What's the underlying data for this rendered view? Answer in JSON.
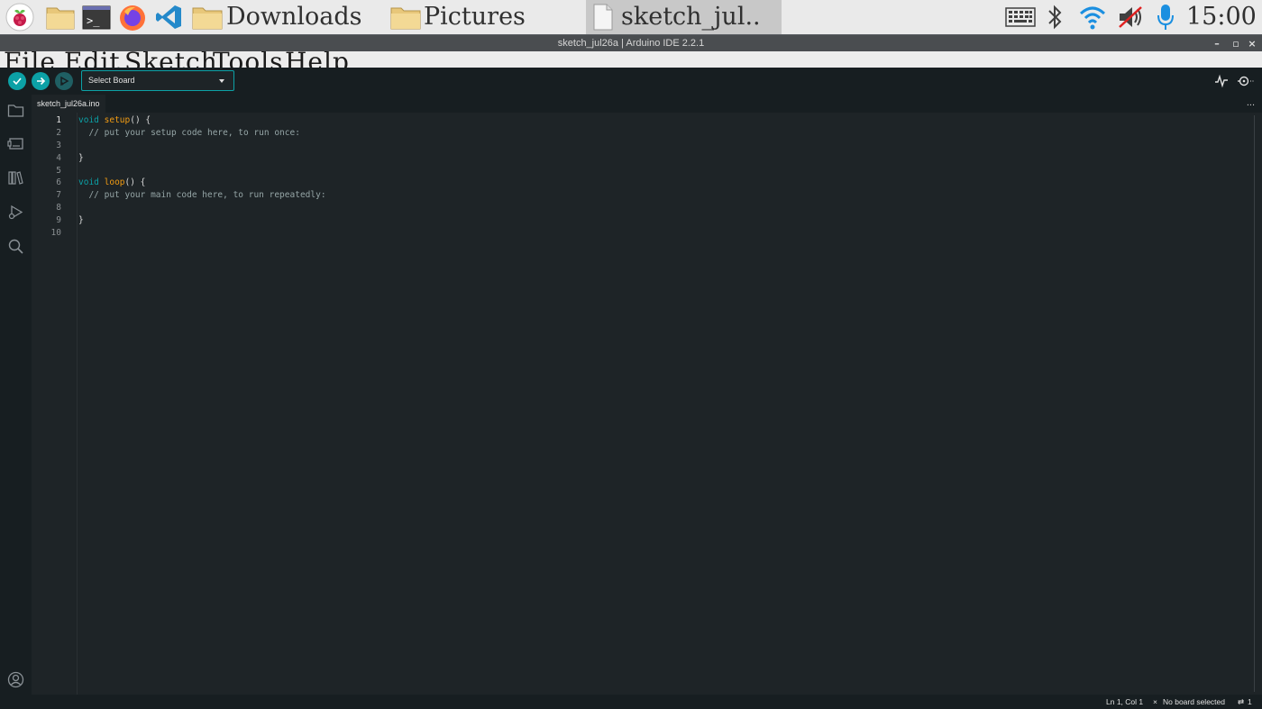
{
  "taskbar": {
    "downloads_label": "Downloads",
    "pictures_label": "Pictures",
    "active_window_label": "sketch_jul..",
    "clock": "15:00"
  },
  "window": {
    "title": "sketch_jul26a | Arduino IDE 2.2.1",
    "minimize": "–",
    "maximize": "▫",
    "close": "×"
  },
  "menu": {
    "file": "File",
    "edit": "Edit",
    "sketch": "Sketch",
    "tools": "Tools",
    "help": "Help"
  },
  "toolbar": {
    "board_select": "Select Board"
  },
  "editor": {
    "tab_label": "sketch_jul26a.ino",
    "more_label": "...",
    "line_numbers": [
      "1",
      "2",
      "3",
      "4",
      "5",
      "6",
      "7",
      "8",
      "9",
      "10"
    ],
    "code": {
      "l1_kw": "void",
      "l1_fn": "setup",
      "l1_rest": "() {",
      "l2": "  // put your setup code here, to run once:",
      "l4": "}",
      "l6_kw": "void",
      "l6_fn": "loop",
      "l6_rest": "() {",
      "l7": "  // put your main code here, to run repeatedly:",
      "l9": "}"
    }
  },
  "status": {
    "position": "Ln 1, Col 1",
    "board": "No board selected",
    "notifications": "1"
  },
  "colors": {
    "accent": "#0ca1a6",
    "function": "#f39c12",
    "comment": "#95a5a6",
    "background": "#1e2427",
    "toolbar_bg": "#171e21"
  }
}
